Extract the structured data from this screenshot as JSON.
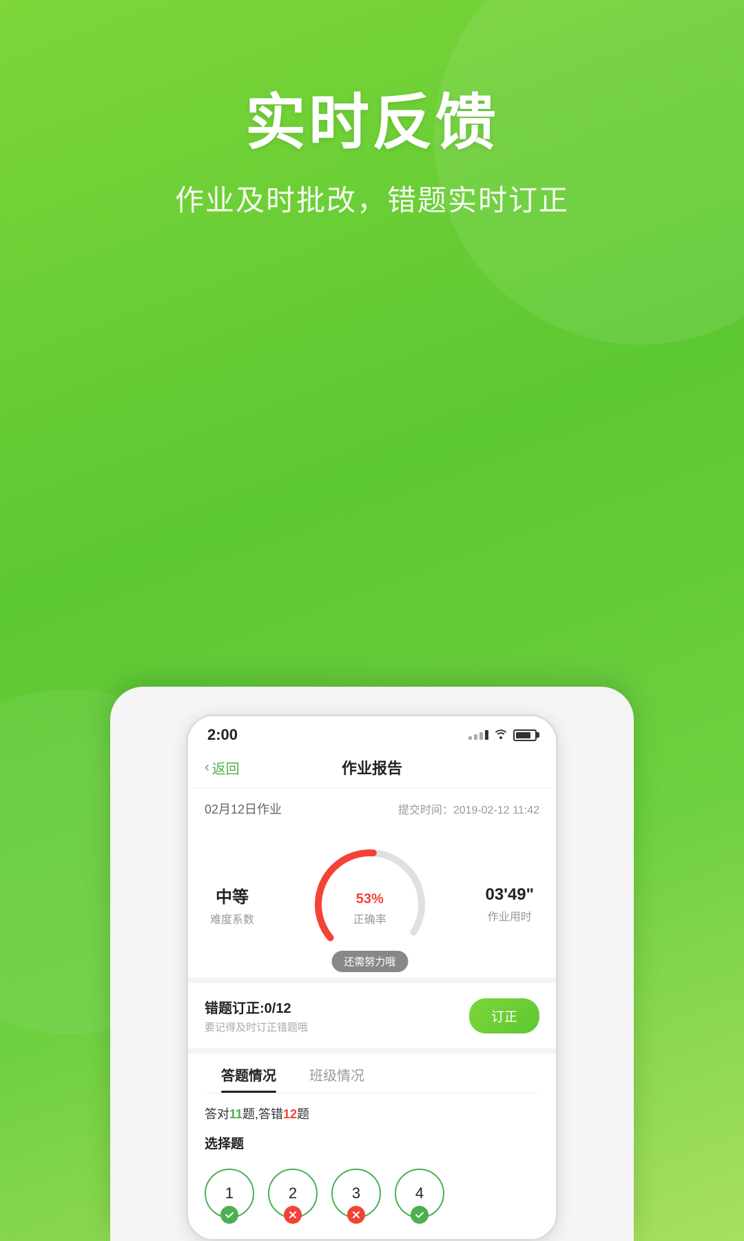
{
  "hero": {
    "title": "实时反馈",
    "subtitle": "作业及时批改，错题实时订正"
  },
  "statusBar": {
    "time": "2:00",
    "batteryLevel": 80
  },
  "navBar": {
    "backLabel": "返回",
    "title": "作业报告"
  },
  "assignmentHeader": {
    "name": "02月12日作业",
    "submitTimeLabel": "提交时间：",
    "submitTime": "2019-02-12 11:42"
  },
  "stats": {
    "difficulty": {
      "value": "中等",
      "label": "难度系数"
    },
    "accuracy": {
      "percent": "53",
      "unit": "%",
      "label": "正确率",
      "encouragement": "还需努力哦"
    },
    "duration": {
      "value": "03'49\"",
      "label": "作业用时"
    }
  },
  "circleChart": {
    "percent": 53,
    "total": 100,
    "strokeColor": "#f44336",
    "bgColor": "#e0e0e0",
    "radius": 75,
    "strokeWidth": 10
  },
  "errorSection": {
    "title": "错题订正:0/12",
    "subtitle": "要记得及时订正错题哦",
    "buttonLabel": "订正"
  },
  "tabs": [
    {
      "id": "answer",
      "label": "答题情况",
      "active": true
    },
    {
      "id": "class",
      "label": "班级情况",
      "active": false
    }
  ],
  "answerStats": {
    "text": "答对",
    "correct": "11",
    "mid": "题,答错",
    "wrong": "12",
    "end": "题"
  },
  "questionType": {
    "label": "选择题"
  },
  "questions": [
    {
      "num": "1",
      "status": "correct"
    },
    {
      "num": "2",
      "status": "wrong"
    },
    {
      "num": "3",
      "status": "wrong"
    },
    {
      "num": "4",
      "status": "correct"
    }
  ],
  "colors": {
    "primary": "#5cc832",
    "accent": "#f44336",
    "correct": "#4caf50",
    "wrong": "#f44336"
  }
}
